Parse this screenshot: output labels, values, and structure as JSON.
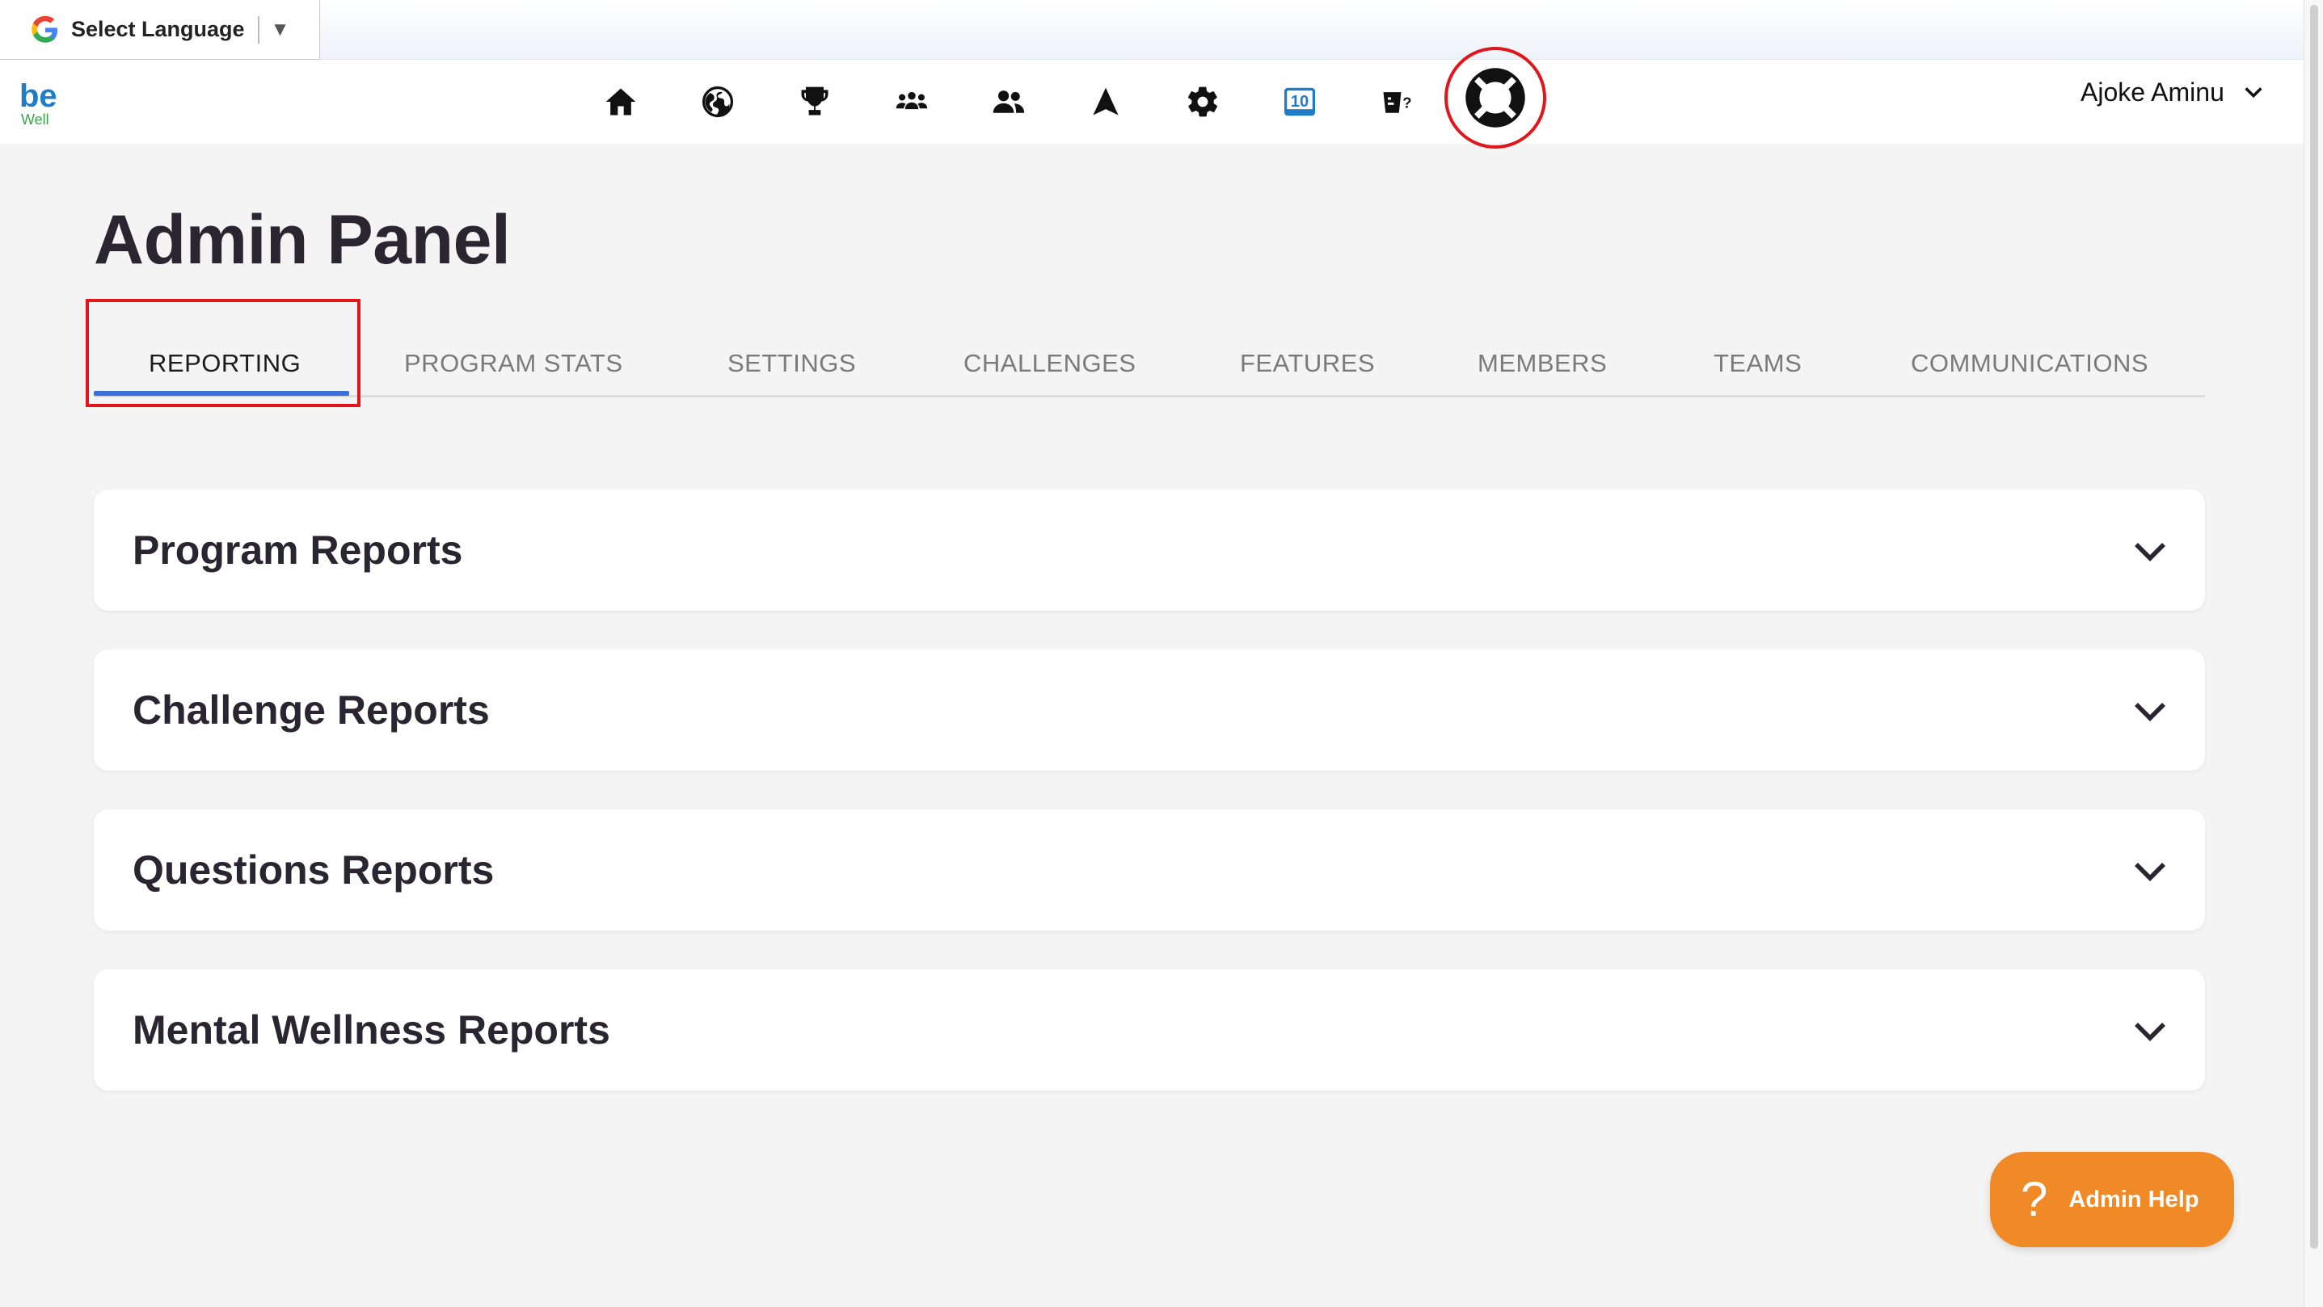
{
  "translate": {
    "label": "Select Language",
    "arrow": "▼"
  },
  "logo": {
    "letters": "be",
    "subtext": "Well"
  },
  "nav": {
    "icons": [
      "home-icon",
      "globe-icon",
      "trophy-icon",
      "group-icon",
      "users-icon",
      "navigation-arrow-icon",
      "gear-icon",
      "calendar-10-icon",
      "quiz-icon",
      "lifebuoy-icon"
    ],
    "badge": "10"
  },
  "user": {
    "name": "Ajoke Aminu"
  },
  "page": {
    "title": "Admin Panel"
  },
  "tabs": [
    {
      "label": "REPORTING",
      "active": true
    },
    {
      "label": "PROGRAM STATS",
      "active": false
    },
    {
      "label": "SETTINGS",
      "active": false
    },
    {
      "label": "CHALLENGES",
      "active": false
    },
    {
      "label": "FEATURES",
      "active": false
    },
    {
      "label": "MEMBERS",
      "active": false
    },
    {
      "label": "TEAMS",
      "active": false
    },
    {
      "label": "COMMUNICATIONS",
      "active": false
    }
  ],
  "reports": [
    {
      "title": "Program Reports"
    },
    {
      "title": "Challenge Reports"
    },
    {
      "title": "Questions Reports"
    },
    {
      "title": "Mental Wellness Reports"
    }
  ],
  "help_button": {
    "symbol": "?",
    "label": "Admin Help"
  },
  "colors": {
    "accent_blue": "#3b6fdd",
    "highlight_red": "#e0161b",
    "help_orange": "#ef8a26"
  }
}
